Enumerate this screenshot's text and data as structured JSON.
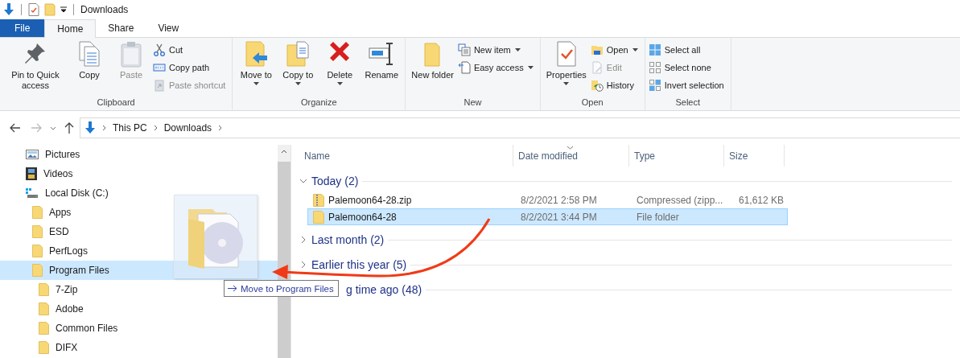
{
  "window": {
    "title": "Downloads"
  },
  "tabs": [
    {
      "label": "File",
      "kind": "file",
      "selected": false
    },
    {
      "label": "Home",
      "kind": "tab",
      "selected": true
    },
    {
      "label": "Share",
      "kind": "tab",
      "selected": false
    },
    {
      "label": "View",
      "kind": "tab",
      "selected": false
    }
  ],
  "ribbon": [
    {
      "name": "Clipboard",
      "items": [
        {
          "kind": "large",
          "label": "Pin to Quick access",
          "disabled": false,
          "dropdown": false
        },
        {
          "kind": "large",
          "label": "Copy",
          "disabled": false,
          "dropdown": false
        },
        {
          "kind": "large",
          "label": "Paste",
          "disabled": true,
          "dropdown": false
        },
        {
          "kind": "stack",
          "items": [
            {
              "label": "Cut",
              "disabled": false,
              "dropdown": false
            },
            {
              "label": "Copy path",
              "disabled": false,
              "dropdown": false
            },
            {
              "label": "Paste shortcut",
              "disabled": true,
              "dropdown": false
            }
          ]
        }
      ]
    },
    {
      "name": "Organize",
      "items": [
        {
          "kind": "large",
          "label": "Move to",
          "disabled": false,
          "dropdown": true
        },
        {
          "kind": "large",
          "label": "Copy to",
          "disabled": false,
          "dropdown": true
        },
        {
          "kind": "large",
          "label": "Delete",
          "disabled": false,
          "dropdown": true
        },
        {
          "kind": "large",
          "label": "Rename",
          "disabled": false,
          "dropdown": false
        }
      ]
    },
    {
      "name": "New",
      "items": [
        {
          "kind": "large",
          "label": "New folder",
          "disabled": false,
          "dropdown": false
        },
        {
          "kind": "stack",
          "items": [
            {
              "label": "New item",
              "disabled": false,
              "dropdown": true
            },
            {
              "label": "Easy access",
              "disabled": false,
              "dropdown": true
            }
          ]
        }
      ]
    },
    {
      "name": "Open",
      "items": [
        {
          "kind": "large",
          "label": "Properties",
          "disabled": false,
          "dropdown": true
        },
        {
          "kind": "stack",
          "items": [
            {
              "label": "Open",
              "disabled": false,
              "dropdown": true
            },
            {
              "label": "Edit",
              "disabled": true,
              "dropdown": false
            },
            {
              "label": "History",
              "disabled": false,
              "dropdown": false
            }
          ]
        }
      ]
    },
    {
      "name": "Select",
      "items": [
        {
          "kind": "stack",
          "items": [
            {
              "label": "Select all",
              "disabled": false,
              "dropdown": false
            },
            {
              "label": "Select none",
              "disabled": false,
              "dropdown": false
            },
            {
              "label": "Invert selection",
              "disabled": false,
              "dropdown": false
            }
          ]
        }
      ]
    }
  ],
  "address": {
    "back_disabled": false,
    "forward_disabled": true,
    "path": [
      "This PC",
      "Downloads"
    ]
  },
  "sidebar": {
    "items": [
      {
        "kind": "pictures",
        "label": "Pictures",
        "selected": false
      },
      {
        "kind": "videos",
        "label": "Videos",
        "selected": false
      },
      {
        "kind": "disk",
        "label": "Local Disk (C:)",
        "selected": false,
        "children": [
          {
            "kind": "folder",
            "label": "Apps",
            "selected": false
          },
          {
            "kind": "folder",
            "label": "ESD",
            "selected": false
          },
          {
            "kind": "folder",
            "label": "PerfLogs",
            "selected": false
          },
          {
            "kind": "folder",
            "label": "Program Files",
            "selected": true,
            "children": [
              {
                "kind": "folder",
                "label": "7-Zip",
                "selected": false
              },
              {
                "kind": "folder",
                "label": "Adobe",
                "selected": false
              },
              {
                "kind": "folder",
                "label": "Common Files",
                "selected": false
              },
              {
                "kind": "folder",
                "label": "DIFX",
                "selected": false
              }
            ]
          }
        ]
      }
    ]
  },
  "table": {
    "columns": [
      {
        "label": "Name",
        "sorted": false
      },
      {
        "label": "Date modified",
        "sorted": true
      },
      {
        "label": "Type",
        "sorted": false
      },
      {
        "label": "Size",
        "sorted": false
      }
    ],
    "groups": [
      {
        "label": "Today (2)",
        "expanded": true,
        "obscured": false,
        "rows": [
          {
            "kind": "zip",
            "name": "Palemoon64-28.zip",
            "date": "8/2/2021 2:58 PM",
            "type": "Compressed (zipp...",
            "size": "61,612 KB",
            "selected": false
          },
          {
            "kind": "folder",
            "name": "Palemoon64-28",
            "date": "8/2/2021 3:44 PM",
            "type": "File folder",
            "selected": true
          }
        ]
      },
      {
        "label": "Last month (2)",
        "expanded": false,
        "obscured": false
      },
      {
        "label": "Earlier this year (5)",
        "expanded": false,
        "obscured": false
      },
      {
        "label": "g time ago (48)",
        "expanded": false,
        "obscured": true
      }
    ]
  },
  "drag": {
    "tooltip": "Move to Program Files"
  }
}
